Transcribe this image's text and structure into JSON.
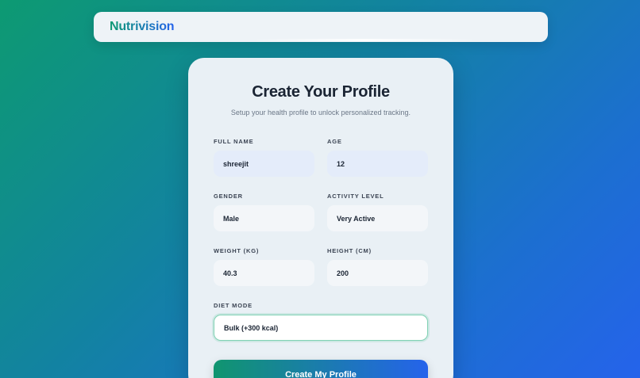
{
  "nav": {
    "brand": "Nutrivision"
  },
  "form": {
    "title": "Create Your Profile",
    "subtitle": "Setup your health profile to unlock personalized tracking.",
    "fields": {
      "full_name": {
        "label": "FULL NAME",
        "value": "shreejit"
      },
      "age": {
        "label": "AGE",
        "value": "12"
      },
      "gender": {
        "label": "GENDER",
        "value": "Male"
      },
      "activity_level": {
        "label": "ACTIVITY LEVEL",
        "value": "Very Active"
      },
      "weight": {
        "label": "WEIGHT (KG)",
        "value": "40.3"
      },
      "height": {
        "label": "HEIGHT (CM)",
        "value": "200"
      },
      "diet_mode": {
        "label": "DIET MODE",
        "value": "Bulk (+300 kcal)"
      }
    },
    "submit_label": "Create My Profile"
  },
  "colors": {
    "gradient_start": "#0d9a72",
    "gradient_end": "#2563eb",
    "card_bg": "#e9f0f5",
    "active_border": "#7fd1b3"
  }
}
